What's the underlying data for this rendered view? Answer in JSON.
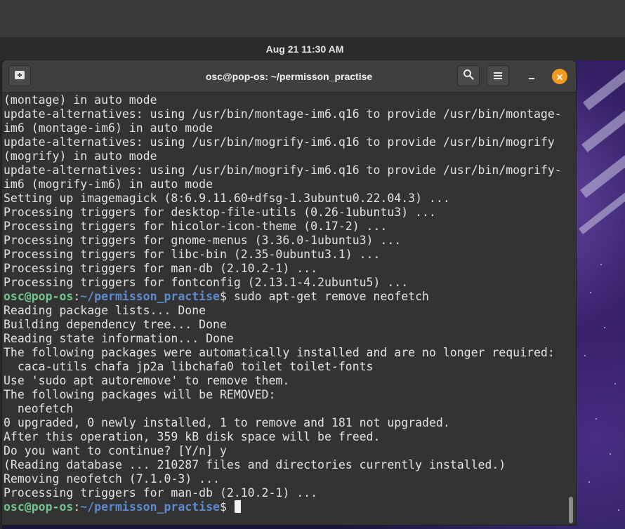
{
  "panel": {
    "datetime": "Aug 21  11:30 AM"
  },
  "window": {
    "title": "osc@pop-os: ~/permisson_practise",
    "new_tab_icon": "new-tab-icon",
    "search_icon": "search-icon",
    "menu_icon": "hamburger-menu-icon",
    "minimize_icon": "minimize-icon",
    "close_icon": "close-icon",
    "close_color": "#f39a1e"
  },
  "colors": {
    "prompt_user": "#73c48f",
    "prompt_path": "#5d8bd0",
    "text": "#e2e2e2",
    "background": "#333333"
  },
  "terminal": {
    "lines": [
      {
        "text": "(montage) in auto mode"
      },
      {
        "text": "update-alternatives: using /usr/bin/montage-im6.q16 to provide /usr/bin/montage-"
      },
      {
        "text": "im6 (montage-im6) in auto mode"
      },
      {
        "text": "update-alternatives: using /usr/bin/mogrify-im6.q16 to provide /usr/bin/mogrify"
      },
      {
        "text": "(mogrify) in auto mode"
      },
      {
        "text": "update-alternatives: using /usr/bin/mogrify-im6.q16 to provide /usr/bin/mogrify-"
      },
      {
        "text": "im6 (mogrify-im6) in auto mode"
      },
      {
        "text": "Setting up imagemagick (8:6.9.11.60+dfsg-1.3ubuntu0.22.04.3) ..."
      },
      {
        "text": "Processing triggers for desktop-file-utils (0.26-1ubuntu3) ..."
      },
      {
        "text": "Processing triggers for hicolor-icon-theme (0.17-2) ..."
      },
      {
        "text": "Processing triggers for gnome-menus (3.36.0-1ubuntu3) ..."
      },
      {
        "text": "Processing triggers for libc-bin (2.35-0ubuntu3.1) ..."
      },
      {
        "text": "Processing triggers for man-db (2.10.2-1) ..."
      },
      {
        "text": "Processing triggers for fontconfig (2.13.1-4.2ubuntu5) ..."
      },
      {
        "prompt": {
          "user": "osc@pop-os",
          "sep": ":",
          "path": "~/permisson_practise",
          "symbol": "$ "
        },
        "text": "sudo apt-get remove neofetch"
      },
      {
        "text": "Reading package lists... Done"
      },
      {
        "text": "Building dependency tree... Done"
      },
      {
        "text": "Reading state information... Done"
      },
      {
        "text": "The following packages were automatically installed and are no longer required:"
      },
      {
        "text": "  caca-utils chafa jp2a libchafa0 toilet toilet-fonts"
      },
      {
        "text": "Use 'sudo apt autoremove' to remove them."
      },
      {
        "text": "The following packages will be REMOVED:"
      },
      {
        "text": "  neofetch"
      },
      {
        "text": "0 upgraded, 0 newly installed, 1 to remove and 181 not upgraded."
      },
      {
        "text": "After this operation, 359 kB disk space will be freed."
      },
      {
        "text": "Do you want to continue? [Y/n] y"
      },
      {
        "text": "(Reading database ... 210287 files and directories currently installed.)"
      },
      {
        "text": "Removing neofetch (7.1.0-3) ..."
      },
      {
        "text": "Processing triggers for man-db (2.10.2-1) ..."
      },
      {
        "prompt": {
          "user": "osc@pop-os",
          "sep": ":",
          "path": "~/permisson_practise",
          "symbol": "$ "
        },
        "text": "",
        "cursor": true
      }
    ]
  }
}
